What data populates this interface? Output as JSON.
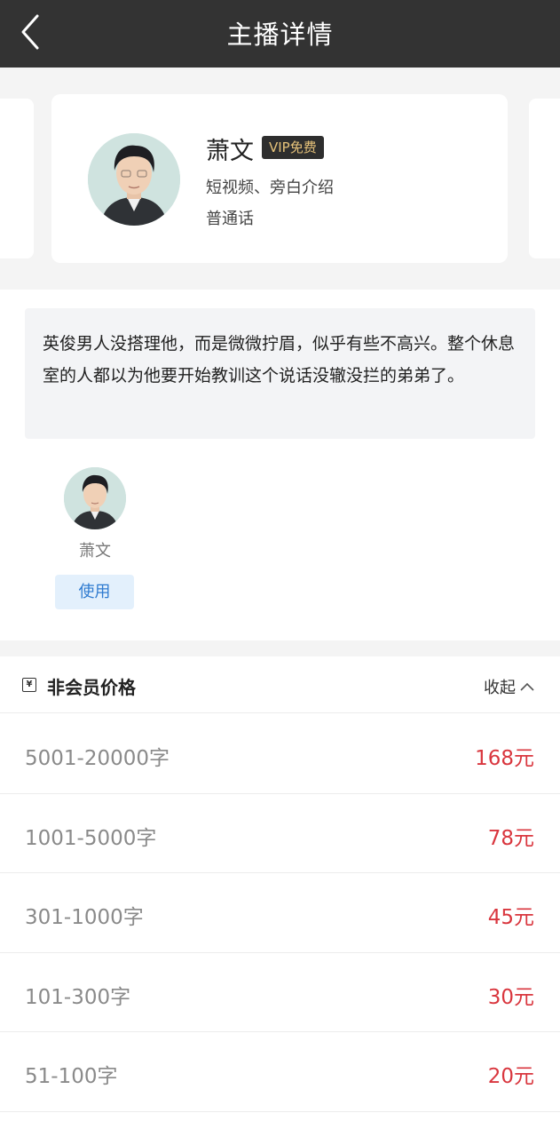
{
  "header": {
    "title": "主播详情",
    "back_icon": "chevron-left-icon"
  },
  "anchor": {
    "name": "萧文",
    "badge": "VIP免费",
    "tags": "短视频、旁白介绍",
    "language": "普通话"
  },
  "description": "英俊男人没搭理他，而是微微拧眉，似乎有些不高兴。整个休息室的人都以为他要开始教训这个说话没辙没拦的弟弟了。",
  "voices": [
    {
      "name": "萧文",
      "action": "使用"
    }
  ],
  "pricing": {
    "title": "非会员价格",
    "collapse_label": "收起",
    "rows": [
      {
        "range": "5001-20000字",
        "price": "168元"
      },
      {
        "range": "1001-5000字",
        "price": "78元"
      },
      {
        "range": "301-1000字",
        "price": "45元"
      },
      {
        "range": "101-300字",
        "price": "30元"
      },
      {
        "range": "51-100字",
        "price": "20元"
      }
    ]
  },
  "colors": {
    "navbar": "#333333",
    "price": "#d9363e",
    "vip_text": "#e6c27a",
    "use_button_bg": "#e3f0fc",
    "use_button_text": "#2f7bd0"
  }
}
